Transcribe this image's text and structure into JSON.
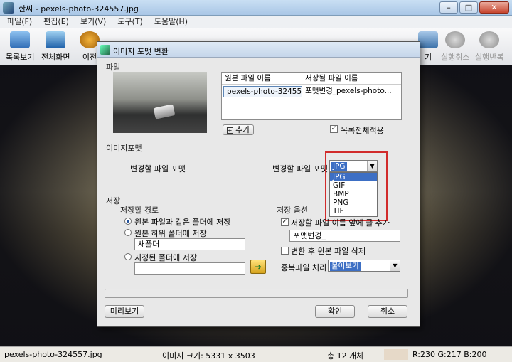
{
  "window": {
    "title": "한씨 - pexels-photo-324557.jpg",
    "controls": {
      "minimize": "–",
      "maximize": "□",
      "close": "✕"
    }
  },
  "menu": [
    "파일(F)",
    "편집(E)",
    "보기(V)",
    "도구(T)",
    "도움말(H)"
  ],
  "toolbar": {
    "list_view": "목록보기",
    "full_screen": "전체화면",
    "prev": "이전",
    "rotate": "기",
    "undo": "실행취소",
    "redo": "실행반복"
  },
  "dialog": {
    "title": "이미지 포맷 변환",
    "file_group": "파일",
    "col_original": "원본 파일 이름",
    "col_saved": "저장될 파일 이름",
    "row_original": "pexels-photo-324557.jpg",
    "row_saved": "포맷변경_pexels-photo...",
    "add_button": "추가",
    "apply_all_label": "목록전체적용",
    "format_group": "이미지포맷",
    "convert_format_label": "변경할 파일 포맷",
    "convert_format_label2": "변경할 파일 포맷",
    "format_selected": "JPG",
    "format_options": [
      "JPG",
      "GIF",
      "BMP",
      "PNG",
      "TIF"
    ],
    "save_group": "저장",
    "save_path_group": "저장할 경로",
    "opt_same_folder": "원본 파일과 같은 폴더에 저장",
    "opt_sub_folder": "원본 하위 폴더에 저장",
    "sub_folder_value": "새폴더",
    "opt_custom_folder": "지정된 폴더에 저장",
    "save_options_group": "저장 옵션",
    "prefix_label": "저장할 파일 이름 앞에 글 추가",
    "prefix_value": "포맷변경_",
    "delete_original_label": "변환 후 원본 파일 삭제",
    "duplicate_label": "중복파일 처리",
    "duplicate_value": "물어보기",
    "preview_button": "미리보기",
    "ok_button": "확인",
    "cancel_button": "취소"
  },
  "status": {
    "filename": "pexels-photo-324557.jpg",
    "image_size": "이미지 크기: 5331 x 3503",
    "total": "총 12 개체",
    "rgb": "R:230 G:217 B:200"
  },
  "colors": {
    "accent_selection": "#3d6fc4",
    "highlight_box": "#d12b2b"
  }
}
